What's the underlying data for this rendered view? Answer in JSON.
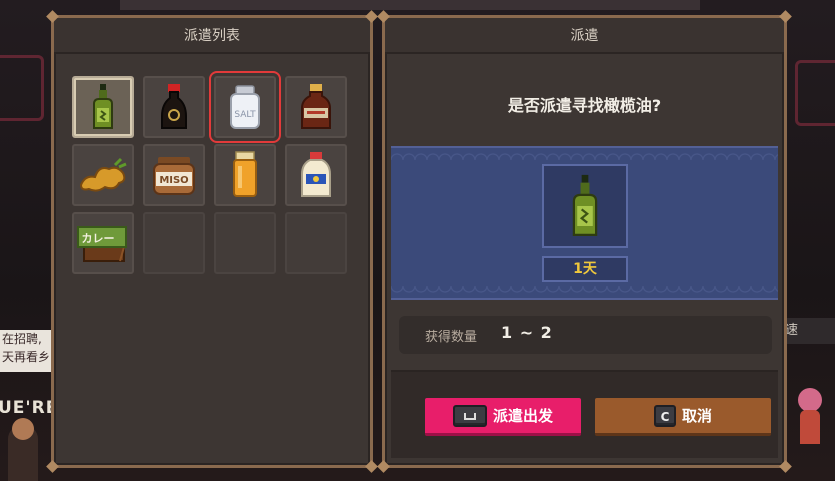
{
  "background": {
    "sign_left_lines": [
      "在招聘,",
      "天再看乡"
    ],
    "uere_text": "UE'RE",
    "tag_right": "速"
  },
  "left_panel": {
    "title": "派遣列表",
    "items": [
      {
        "name": "olive-oil-bottle-icon",
        "state": "selected"
      },
      {
        "name": "soy-sauce-bottle-icon",
        "state": "normal"
      },
      {
        "name": "salt-shaker-icon",
        "state": "highlighted",
        "label": "SALT"
      },
      {
        "name": "sauce-bottle-icon",
        "state": "normal"
      },
      {
        "name": "ginger-root-icon",
        "state": "normal"
      },
      {
        "name": "miso-jar-icon",
        "state": "normal",
        "label": "MISO"
      },
      {
        "name": "spice-jar-icon",
        "state": "normal"
      },
      {
        "name": "mayonnaise-icon",
        "state": "normal"
      },
      {
        "name": "curry-block-icon",
        "state": "normal",
        "label": "カレー"
      },
      {
        "name": "empty-slot",
        "state": "empty"
      },
      {
        "name": "empty-slot",
        "state": "empty"
      },
      {
        "name": "empty-slot",
        "state": "empty"
      }
    ]
  },
  "right_panel": {
    "title": "派遣",
    "question": "是否派遣寻找橄榄油?",
    "reward_icon": "olive-oil-bottle-icon",
    "duration": "1天",
    "quantity_label": "获得数量",
    "quantity_value": "1 ~ 2",
    "dispatch_key": "",
    "dispatch_label": "派遣出发",
    "cancel_key": "C",
    "cancel_label": "取消"
  },
  "colors": {
    "dispatch_button": "#e81e6a",
    "cancel_button": "#9a5a2c",
    "band": "#3b4a7a",
    "duration_text": "#f0c83c",
    "highlight_box": "#e23a3a"
  }
}
